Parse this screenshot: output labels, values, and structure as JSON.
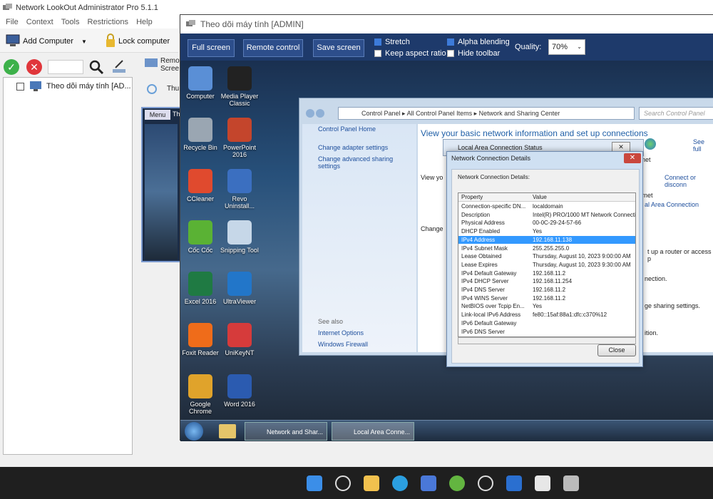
{
  "app": {
    "title": "Network LookOut Administrator Pro 5.1.1",
    "menu": [
      "File",
      "Context",
      "Tools",
      "Restrictions",
      "Help"
    ],
    "toolbar": {
      "add_computer": "Add Computer",
      "lock_computer": "Lock computer"
    },
    "tree_item": "Theo dõi máy tính [AD...",
    "tabs": [
      "Remo",
      "Scree",
      "Thu"
    ],
    "thumb_menu": "Menu",
    "thumb_label": "Th"
  },
  "viewer": {
    "title": "Theo dõi máy tính [ADMIN]",
    "buttons": {
      "full_screen": "Full screen",
      "remote_control": "Remote control",
      "save_screen": "Save screen"
    },
    "options": {
      "stretch": "Stretch",
      "keep_aspect": "Keep aspect ratio",
      "alpha": "Alpha blending",
      "hide_toolbar": "Hide toolbar"
    },
    "quality_label": "Quality:",
    "quality_value": "70%"
  },
  "desktop": {
    "icons": [
      {
        "label": "Computer",
        "color": "#5a8fd6"
      },
      {
        "label": "Media Player Classic",
        "color": "#222"
      },
      {
        "label": "Recycle Bin",
        "color": "#9aa6b2"
      },
      {
        "label": "PowerPoint 2016",
        "color": "#c4452c"
      },
      {
        "label": "CCleaner",
        "color": "#e04a2e"
      },
      {
        "label": "Revo Uninstall...",
        "color": "#3b6fc0"
      },
      {
        "label": "Cốc Cốc",
        "color": "#5ab234"
      },
      {
        "label": "Snipping Tool",
        "color": "#c6d7e8"
      },
      {
        "label": "Excel 2016",
        "color": "#1f7a43"
      },
      {
        "label": "UltraViewer",
        "color": "#2276c9"
      },
      {
        "label": "Foxit Reader",
        "color": "#ef6c1a"
      },
      {
        "label": "UniKeyNT",
        "color": "#d63b3b"
      },
      {
        "label": "Google Chrome",
        "color": "#e0a32b"
      },
      {
        "label": "Word 2016",
        "color": "#2b5bb0"
      }
    ],
    "taskbar": [
      "Network and Shar...",
      "Local Area Conne..."
    ]
  },
  "control_panel": {
    "breadcrumb": [
      "Control Panel",
      "All Control Panel Items",
      "Network and Sharing Center"
    ],
    "search_placeholder": "Search Control Panel",
    "left_links": [
      "Control Panel Home",
      "Change adapter settings",
      "Change advanced sharing settings"
    ],
    "see_also": "See also",
    "see_also_links": [
      "Internet Options",
      "Windows Firewall"
    ],
    "main_title": "View your basic network information and set up connections",
    "see_full": "See full",
    "fragments": [
      "net",
      "Connect or disconn",
      "View yo",
      "rnet",
      "al Area Connection",
      "Change",
      "t up a router or access p",
      "nection.",
      "ge sharing settings.",
      "ition."
    ]
  },
  "status_dialog": {
    "title": "Local Area Connection Status"
  },
  "details_dialog": {
    "title": "Network Connection Details",
    "label": "Network Connection Details:",
    "headers": [
      "Property",
      "Value"
    ],
    "rows": [
      [
        "Connection-specific DN...",
        "localdomain"
      ],
      [
        "Description",
        "Intel(R) PRO/1000 MT Network Connecti"
      ],
      [
        "Physical Address",
        "00-0C-29-24-57-66"
      ],
      [
        "DHCP Enabled",
        "Yes"
      ],
      [
        "IPv4 Address",
        "192.168.11.138"
      ],
      [
        "IPv4 Subnet Mask",
        "255.255.255.0"
      ],
      [
        "Lease Obtained",
        "Thursday, August 10, 2023 9:00:00 AM"
      ],
      [
        "Lease Expires",
        "Thursday, August 10, 2023 9:30:00 AM"
      ],
      [
        "IPv4 Default Gateway",
        "192.168.11.2"
      ],
      [
        "IPv4 DHCP Server",
        "192.168.11.254"
      ],
      [
        "IPv4 DNS Server",
        "192.168.11.2"
      ],
      [
        "IPv4 WINS Server",
        "192.168.11.2"
      ],
      [
        "NetBIOS over Tcpip En...",
        "Yes"
      ],
      [
        "Link-local IPv6 Address",
        "fe80::15af:88a1:dfc:c370%12"
      ],
      [
        "IPv6 Default Gateway",
        ""
      ],
      [
        "IPv6 DNS Server",
        ""
      ]
    ],
    "selected_row": 4,
    "close": "Close"
  },
  "win11_taskbar": [
    "start-icon",
    "search-icon",
    "file-explorer-icon",
    "edge-icon",
    "store-icon",
    "coccoc-icon",
    "media-player-icon",
    "defender-icon",
    "lookout-icon",
    "network-icon"
  ]
}
